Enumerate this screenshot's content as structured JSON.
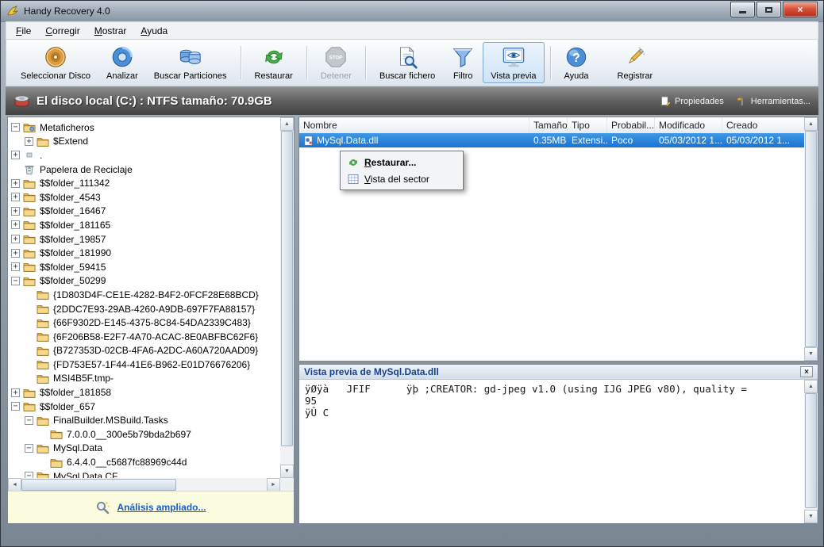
{
  "window": {
    "title": "Handy Recovery 4.0"
  },
  "menu": {
    "items": [
      {
        "label": "File"
      },
      {
        "label": "Corregir"
      },
      {
        "label": "Mostrar"
      },
      {
        "label": "Ayuda"
      }
    ]
  },
  "toolbar": {
    "buttons": [
      {
        "label": "Seleccionar Disco",
        "icon": "disk-icon"
      },
      {
        "label": "Analizar",
        "icon": "analyze-icon"
      },
      {
        "label": "Buscar Particiones",
        "icon": "partitions-icon"
      },
      {
        "label": "Restaurar",
        "icon": "restore-icon"
      },
      {
        "label": "Detener",
        "icon": "stop-icon",
        "disabled": true
      },
      {
        "label": "Buscar fichero",
        "icon": "search-file-icon"
      },
      {
        "label": "Filtro",
        "icon": "filter-icon"
      },
      {
        "label": "Vista previa",
        "icon": "preview-icon",
        "active": true
      },
      {
        "label": "Ayuda",
        "icon": "help-icon"
      },
      {
        "label": "Registrar",
        "icon": "register-icon"
      }
    ]
  },
  "disk_header": {
    "text": "El disco local (C:) : NTFS tamaño: 70.9GB",
    "properties_label": "Propiedades",
    "tools_label": "Herramientas..."
  },
  "tree": {
    "items": [
      {
        "label": "Metaficheros",
        "level": 0,
        "expand": "minus",
        "icon": "metafiles-icon"
      },
      {
        "label": "$Extend",
        "level": 1,
        "expand": "plus",
        "icon": "folder-icon"
      },
      {
        "label": ".",
        "level": 0,
        "expand": "plus",
        "icon": "dot-icon"
      },
      {
        "label": "Papelera de Reciclaje",
        "level": 0,
        "expand": "none",
        "icon": "recycle-icon"
      },
      {
        "label": "$$folder_111342",
        "level": 0,
        "expand": "plus",
        "icon": "folder-icon"
      },
      {
        "label": "$$folder_4543",
        "level": 0,
        "expand": "plus",
        "icon": "folder-icon"
      },
      {
        "label": "$$folder_16467",
        "level": 0,
        "expand": "plus",
        "icon": "folder-icon"
      },
      {
        "label": "$$folder_181165",
        "level": 0,
        "expand": "plus",
        "icon": "folder-icon"
      },
      {
        "label": "$$folder_19857",
        "level": 0,
        "expand": "plus",
        "icon": "folder-icon"
      },
      {
        "label": "$$folder_181990",
        "level": 0,
        "expand": "plus",
        "icon": "folder-icon"
      },
      {
        "label": "$$folder_59415",
        "level": 0,
        "expand": "plus",
        "icon": "folder-icon"
      },
      {
        "label": "$$folder_50299",
        "level": 0,
        "expand": "minus",
        "icon": "folder-icon"
      },
      {
        "label": "{1D803D4F-CE1E-4282-B4F2-0FCF28E68BCD}",
        "level": 1,
        "expand": "none",
        "icon": "folder-icon"
      },
      {
        "label": "{2DDC7E93-29AB-4260-A9DB-697F7FA88157}",
        "level": 1,
        "expand": "none",
        "icon": "folder-icon"
      },
      {
        "label": "{66F9302D-E145-4375-8C84-54DA2339C483}",
        "level": 1,
        "expand": "none",
        "icon": "folder-icon"
      },
      {
        "label": "{6F206B58-E2F7-4A70-ACAC-8E0ABFBC62F6}",
        "level": 1,
        "expand": "none",
        "icon": "folder-icon"
      },
      {
        "label": "{B727353D-02CB-4FA6-A2DC-A60A720AAD09}",
        "level": 1,
        "expand": "none",
        "icon": "folder-icon"
      },
      {
        "label": "{FD753E57-1F44-41E6-B962-E01D76676206}",
        "level": 1,
        "expand": "none",
        "icon": "folder-icon"
      },
      {
        "label": "MSI4B5F.tmp-",
        "level": 1,
        "expand": "none",
        "icon": "folder-icon"
      },
      {
        "label": "$$folder_181858",
        "level": 0,
        "expand": "plus",
        "icon": "folder-icon"
      },
      {
        "label": "$$folder_657",
        "level": 0,
        "expand": "minus",
        "icon": "folder-icon"
      },
      {
        "label": "FinalBuilder.MSBuild.Tasks",
        "level": 1,
        "expand": "minus",
        "icon": "folder-icon"
      },
      {
        "label": "7.0.0.0__300e5b79bda2b697",
        "level": 2,
        "expand": "none",
        "icon": "folder-icon"
      },
      {
        "label": "MySql.Data",
        "level": 1,
        "expand": "minus",
        "icon": "folder-icon"
      },
      {
        "label": "6.4.4.0__c5687fc88969c44d",
        "level": 2,
        "expand": "none",
        "icon": "folder-icon"
      },
      {
        "label": "MySql.Data.CF",
        "level": 1,
        "expand": "minus",
        "icon": "folder-icon"
      }
    ]
  },
  "file_list": {
    "columns": [
      "Nombre",
      "Tamaño",
      "Tipo",
      "Probabil...",
      "Modificado",
      "Creado"
    ],
    "rows": [
      {
        "name": "MySql.Data.dll",
        "size": "0.35MB",
        "type": "Extensi...",
        "probability": "Poco",
        "modified": "05/03/2012 1...",
        "created": "05/03/2012 1...",
        "selected": true
      }
    ]
  },
  "context_menu": {
    "items": [
      {
        "label": "Restaurar...",
        "icon": "restore-icon",
        "bold": true
      },
      {
        "label": "Vista del sector",
        "icon": "sector-icon"
      }
    ]
  },
  "preview": {
    "title": "Vista previa de MySql.Data.dll",
    "lines": [
      "ÿØÿà   JFIF      ÿþ ;CREATOR: gd-jpeg v1.0 (using IJG JPEG v80), quality =",
      "95",
      "ÿÛ C"
    ]
  },
  "footer": {
    "link": "Análisis ampliado..."
  },
  "colors": {
    "selection_blue": "#1a73d2",
    "footer_yellow": "#fbfbdf",
    "link_blue": "#1b5cc8",
    "disk_bar_gray": "#4a4a4a"
  }
}
